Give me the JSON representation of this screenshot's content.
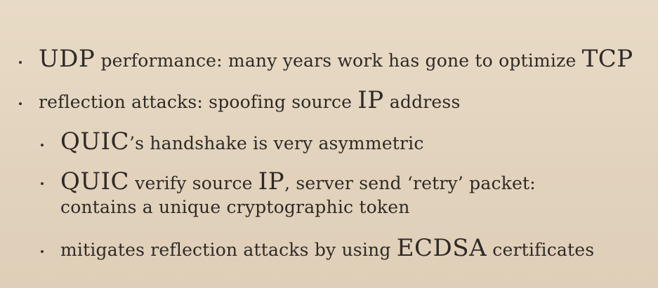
{
  "bullets": [
    {
      "lead": "UDP",
      "text": " performance: many years work has gone to optimize ",
      "tail": "TCP"
    },
    {
      "text": "reflection attacks: spoofing source ",
      "lead2": "IP",
      "tail": " address"
    }
  ],
  "sub_bullets": [
    {
      "lead": "QUIC",
      "text": "’s handshake is very asymmetric"
    },
    {
      "lead": "QUIC",
      "text": " verify source ",
      "lead2": "IP",
      "tail": ", server send ‘retry’ packet: contains a unique cryptographic token"
    },
    {
      "text": "mitigates reflection attacks by using ",
      "lead2": "ECDSA",
      "tail": " certificates"
    }
  ]
}
